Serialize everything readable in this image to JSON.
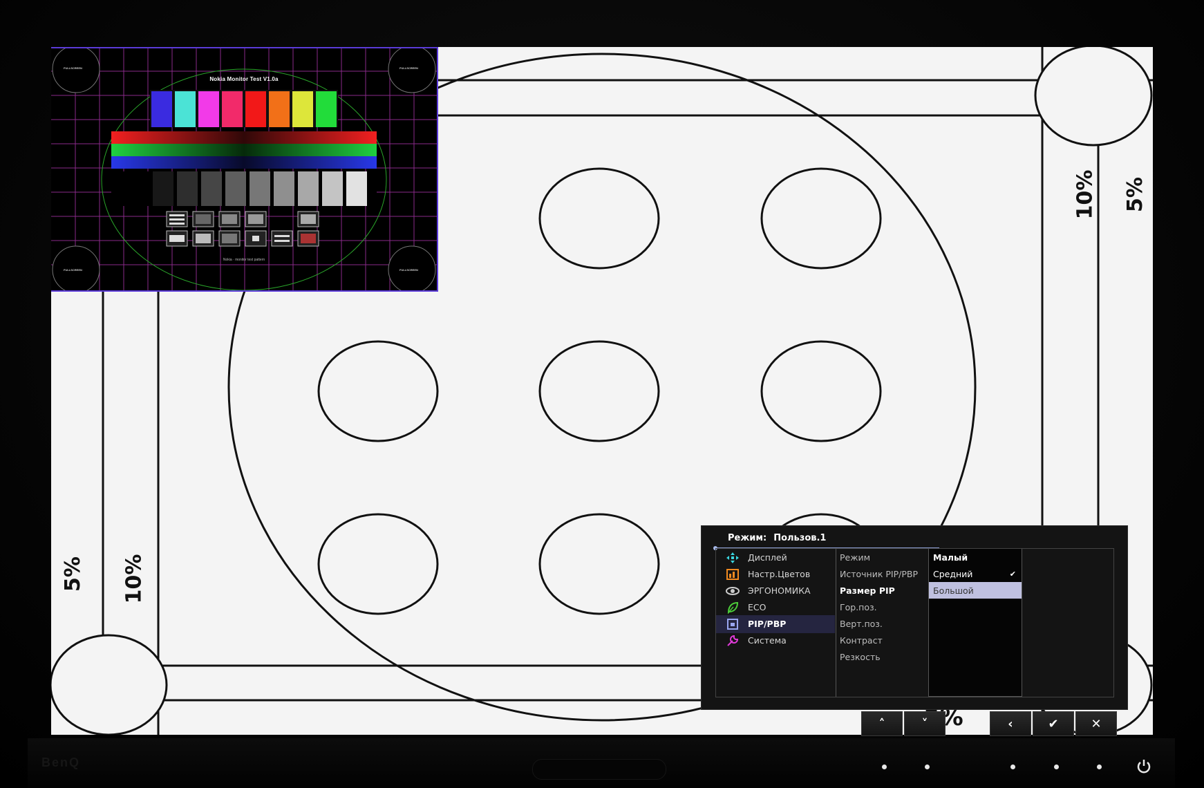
{
  "pip": {
    "title": "Nokia Monitor Test V1.0a",
    "footer": "Nokia · monitor test pattern",
    "corner_label": "FULLSCREEN"
  },
  "pattern": {
    "pct_5": "5%",
    "pct_10": "10%"
  },
  "osd": {
    "mode_label": "Режим:",
    "mode_value": "Пользов.1",
    "menu": [
      {
        "label": "Дисплей",
        "icon": "display-icon"
      },
      {
        "label": "Настр.Цветов",
        "icon": "color-settings-icon"
      },
      {
        "label": "ЭРГОНОМИКА",
        "icon": "eye-icon"
      },
      {
        "label": "ECO",
        "icon": "leaf-icon"
      },
      {
        "label": "PIP/PBP",
        "icon": "pip-icon"
      },
      {
        "label": "Система",
        "icon": "wrench-icon"
      }
    ],
    "submenu": [
      "Режим",
      "Источник PIP/PBP",
      "Размер PIP",
      "Гор.поз.",
      "Верт.поз.",
      "Контраст",
      "Резкость"
    ],
    "options": [
      "Малый",
      "Средний",
      "Большой"
    ],
    "checked_option": "Средний",
    "check_mark": "✔"
  },
  "keys": {
    "up": "˄",
    "down": "˅",
    "back": "‹",
    "ok": "✔",
    "close": "✕"
  },
  "bezel": {
    "brand": "BenQ"
  },
  "colors": {
    "pip_border": "#5b3bd9",
    "osd_selected": "#bfc0e0",
    "osd_background": "#141414"
  }
}
